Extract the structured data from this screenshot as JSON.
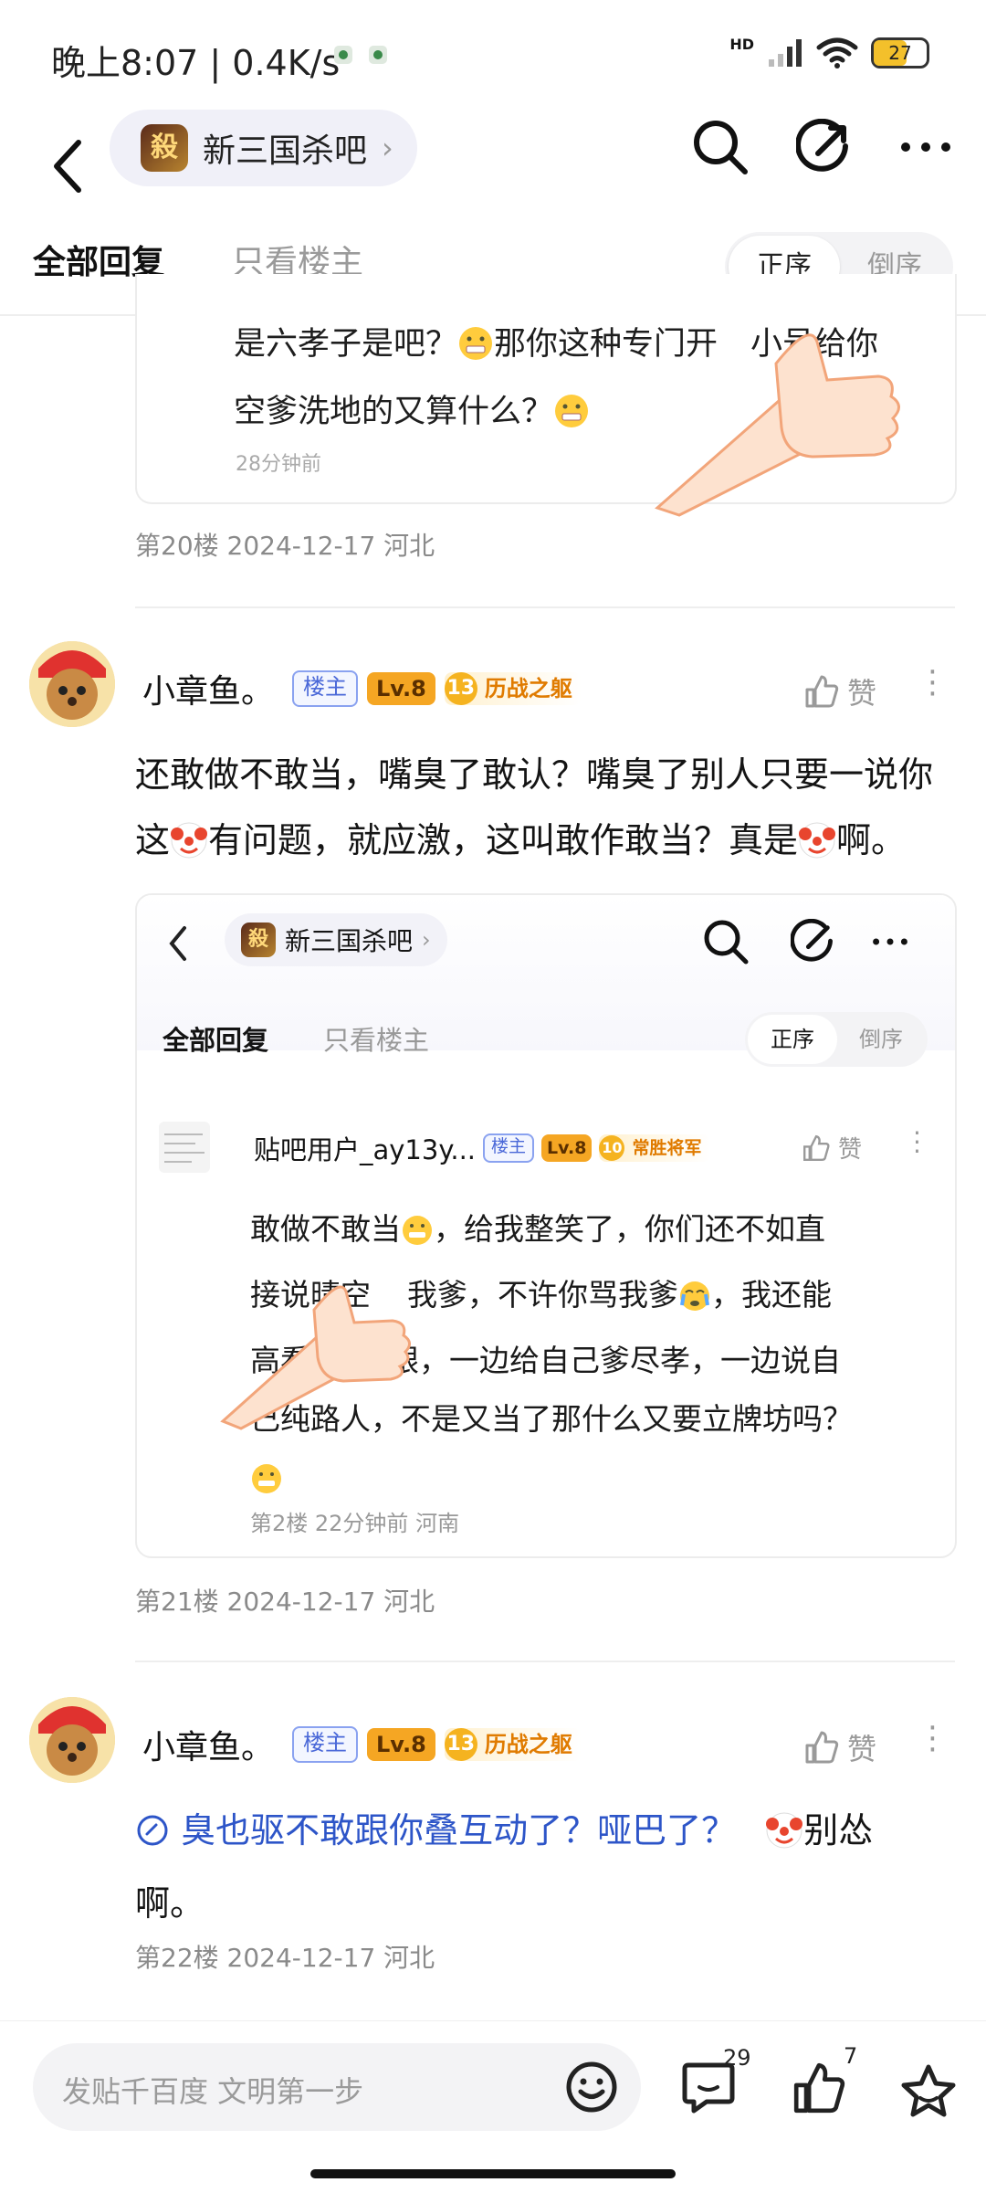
{
  "status_bar": {
    "time": "晚上8:07 | 0.4K/s",
    "network_tag": "HD",
    "battery": "27"
  },
  "nav": {
    "forum_name": "新三国杀吧",
    "forum_logo_char": "殺"
  },
  "tabs": {
    "all": "全部回复",
    "owner_only": "只看楼主"
  },
  "order": {
    "asc": "正序",
    "desc": "倒序"
  },
  "floor20": {
    "quote_line1": "是六孝子是吧？",
    "quote_line1b": "那你这种专门开",
    "quote_line1c": "小号给你",
    "quote_line2": "空爹洗地的又算什么？",
    "quote_time": "28分钟前",
    "meta": "第20楼  2024-12-17  河北"
  },
  "post21": {
    "user": "小章鱼。",
    "badge_owner": "楼主",
    "badge_level": "Lv.8",
    "badge_title_num": "13",
    "badge_title": "历战之躯",
    "like": "赞",
    "text_line1": "还敢做不敢当，嘴臭了敢认？嘴臭了别人只要一说你",
    "text_line2a": "这",
    "text_line2b": "有问题，就应激，这叫敢作敢当？真是",
    "text_line2c": "啊。",
    "inner": {
      "forum_name": "新三国杀吧",
      "forum_logo_char": "殺",
      "tab_all": "全部回复",
      "tab_owner": "只看楼主",
      "asc": "正序",
      "desc": "倒序",
      "user": "贴吧用户_ay13y...",
      "badge_owner": "楼主",
      "badge_level": "Lv.8",
      "badge_title_num": "10",
      "badge_title": "常胜将军",
      "like": "赞",
      "line1a": "敢做不敢当",
      "line1b": "，给我整笑了，你们还不如直",
      "line2a": "接说晴空",
      "line2b": "我爹，不许你骂我爹",
      "line2c": "，我还能",
      "line3a": "高看",
      "line3b": "们一眼，一边给自己爹尽孝，一边说自",
      "line4": "己纯路人，不是又当了那什么又要立牌坊吗？",
      "meta": "第2楼  22分钟前  河南"
    },
    "meta": "第21楼  2024-12-17  河北"
  },
  "post22": {
    "user": "小章鱼。",
    "badge_owner": "楼主",
    "badge_level": "Lv.8",
    "badge_title_num": "13",
    "badge_title": "历战之躯",
    "like": "赞",
    "link_text": "臭也驱不敢跟你叠互动了？哑巴了？",
    "text_tail": "别怂",
    "text_line2": "啊。",
    "meta": "第22楼  2024-12-17  河北"
  },
  "bottom_bar": {
    "input_placeholder": "发贴千百度 文明第一步",
    "comment_count": "29",
    "like_count": "7"
  },
  "colors": {
    "accent_blue": "#2d55c8",
    "badge_orange": "#f5a623",
    "owner_badge": "#4a68d8"
  }
}
